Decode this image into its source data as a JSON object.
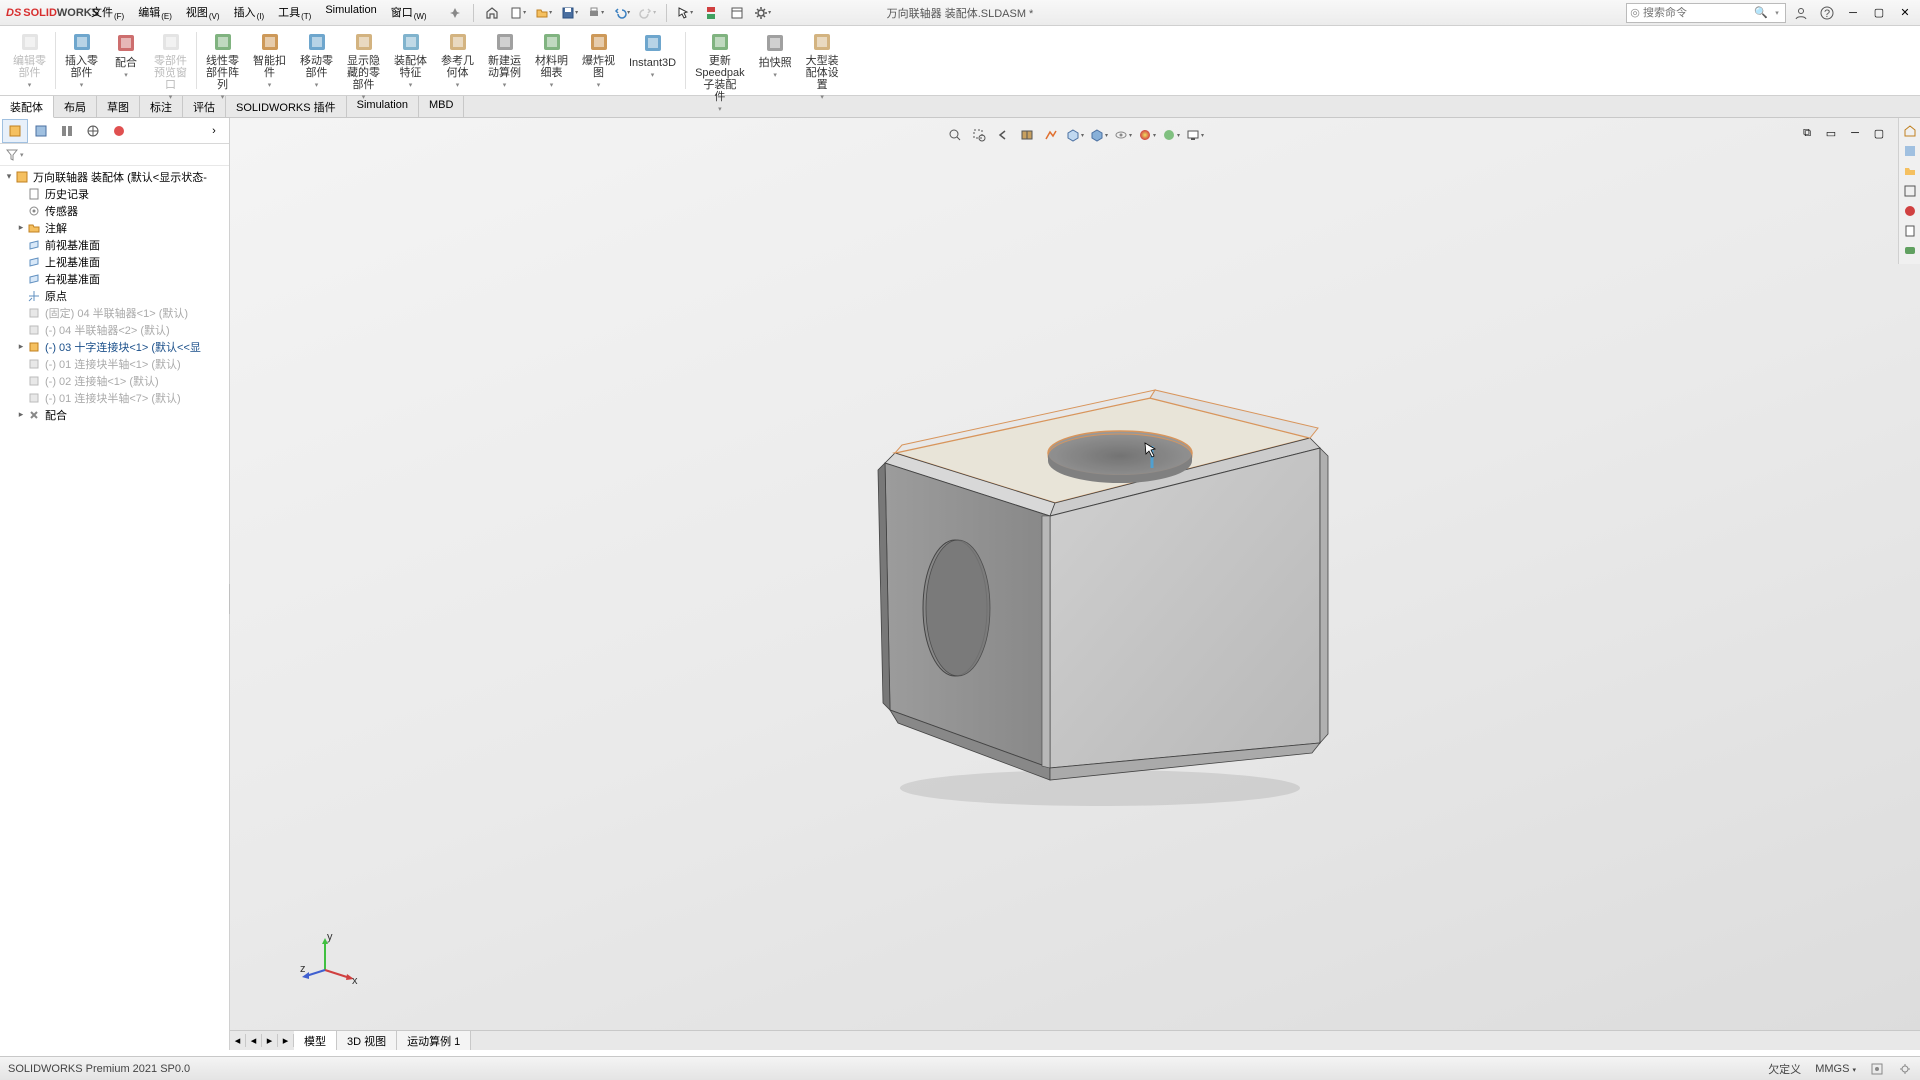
{
  "app": {
    "logo": "SOLIDWORKS",
    "title": "万向联轴器 装配体.SLDASM *"
  },
  "menu": [
    {
      "l": "文件",
      "s": "(F)"
    },
    {
      "l": "编辑",
      "s": "(E)"
    },
    {
      "l": "视图",
      "s": "(V)"
    },
    {
      "l": "插入",
      "s": "(I)"
    },
    {
      "l": "工具",
      "s": "(T)"
    },
    {
      "l": "Simulation",
      "s": ""
    },
    {
      "l": "窗口",
      "s": "(W)"
    }
  ],
  "search": {
    "ph": "搜索命令"
  },
  "ribbon": [
    {
      "l": "编辑零\n部件",
      "dis": true
    },
    {
      "l": "插入零\n部件"
    },
    {
      "l": "配合"
    },
    {
      "l": "零部件\n预览窗\n口",
      "dis": true
    },
    {
      "l": "线性零\n部件阵\n列"
    },
    {
      "l": "智能扣\n件"
    },
    {
      "l": "移动零\n部件"
    },
    {
      "l": "显示隐\n藏的零\n部件"
    },
    {
      "l": "装配体\n特征"
    },
    {
      "l": "参考几\n何体"
    },
    {
      "l": "新建运\n动算例"
    },
    {
      "l": "材料明\n细表"
    },
    {
      "l": "爆炸视\n图"
    },
    {
      "l": "Instant3D"
    },
    {
      "l": "更新\nSpeedpak\n子装配\n件"
    },
    {
      "l": "拍快照"
    },
    {
      "l": "大型装\n配体设\n置"
    }
  ],
  "tabs": [
    "装配体",
    "布局",
    "草图",
    "标注",
    "评估",
    "SOLIDWORKS 插件",
    "Simulation",
    "MBD"
  ],
  "tree": {
    "root": "万向联轴器 装配体  (默认<显示状态-",
    "items": [
      {
        "ic": "history",
        "l": "历史记录"
      },
      {
        "ic": "sensor",
        "l": "传感器"
      },
      {
        "ic": "folder",
        "l": "注解",
        "exp": "▸"
      },
      {
        "ic": "plane",
        "l": "前视基准面"
      },
      {
        "ic": "plane",
        "l": "上视基准面"
      },
      {
        "ic": "plane",
        "l": "右视基准面"
      },
      {
        "ic": "origin",
        "l": "原点"
      },
      {
        "ic": "part-sup",
        "l": "(固定) 04 半联轴器<1> (默认)"
      },
      {
        "ic": "part-sup",
        "l": "(-) 04 半联轴器<2> (默认)"
      },
      {
        "ic": "part",
        "l": "(-) 03 十字连接块<1> (默认<<显",
        "exp": "▸",
        "active": true
      },
      {
        "ic": "part-sup",
        "l": "(-) 01 连接块半轴<1> (默认)"
      },
      {
        "ic": "part-sup",
        "l": "(-) 02 连接轴<1> (默认)"
      },
      {
        "ic": "part-sup",
        "l": "(-) 01 连接块半轴<7> (默认)"
      },
      {
        "ic": "mates",
        "l": "配合",
        "exp": "▸"
      }
    ]
  },
  "btabs": [
    "模型",
    "3D 视图",
    "运动算例 1"
  ],
  "status": {
    "left": "SOLIDWORKS Premium 2021 SP0.0",
    "def": "欠定义",
    "units": "MMGS"
  }
}
